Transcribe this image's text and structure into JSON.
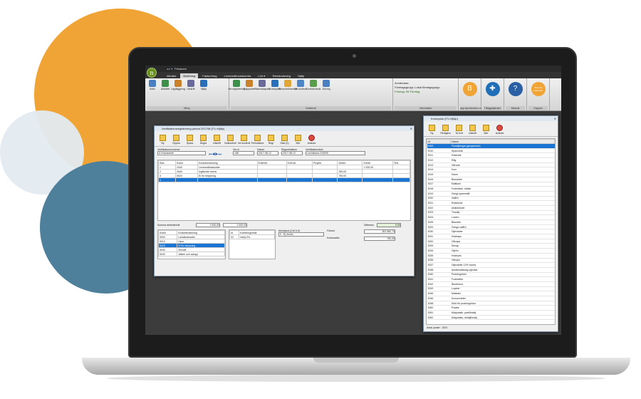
{
  "app": {
    "window_title": "Pekakam",
    "tabs": [
      "Allmänt",
      "Bokföring",
      "Fakturering",
      "Leverantörsreskontra",
      "Lön ▾",
      "Tidredovisning",
      "Hjälp"
    ],
    "active_tab": "Bokföring"
  },
  "ribbon": {
    "groups": [
      {
        "title": "Meny",
        "buttons": [
          "Arkiv",
          "Aktivitet",
          "Uppläggning",
          "Utskrift",
          "Hjälp"
        ]
      },
      {
        "title": "Snabbval",
        "buttons": [
          "Ver.registrering",
          "Rapporter",
          "Räkenskapsår",
          "Kontoplan",
          "Ekonomiöversikt",
          "Ver.kontroll",
          "Kontokontroll",
          "Anl.reg"
        ]
      },
      {
        "title": "Information",
        "lines": [
          "Användare:",
          "Företagsgrupp: Lokal företagsgrupp",
          "Företag: f9t Företag"
        ]
      }
    ],
    "links": [
      {
        "label": "app.bjornlunden.se",
        "text": "B",
        "color": "#f0a435"
      },
      {
        "label": "Tilläggstjänster",
        "text": "✚",
        "color": "#1e6fb8"
      },
      {
        "label": "Manual",
        "text": "?",
        "color": "#2a5fa3"
      },
      {
        "label": "Support",
        "text": "Skriv till supporten",
        "color": "#f0a435"
      }
    ]
  },
  "ver_window": {
    "title": "Verifikationsregistrering period 201708 (F1=Hjälp)",
    "toolbar": [
      "Ny",
      "Öppna",
      "Spara",
      "Ångra",
      "Utskrift",
      "Nolkontroll",
      "Ver.kontroll",
      "Periodisera",
      "Regr",
      "Disk (0)",
      "Mer",
      "Avsluta"
    ],
    "labels": {
      "verifikationsnummer": "Verifikationsnummer",
      "ver_nr": "Ver.nr",
      "datum": "Datum",
      "rapportdatum": "Rapportdatum",
      "verifikationstext": "Verifikationstext"
    },
    "fields": {
      "series": "A Huvudserie",
      "ver_nr": "158",
      "datum": "2017-08-12",
      "rapportdatum": "2017-08-12",
      "text": "Lev.faktura 215009"
    },
    "columns": [
      "Rad",
      "Konto",
      "Kontobenämning",
      "Kvitt/Ver",
      "Kr/Kvitt",
      "Projekt",
      "Debet",
      "Kredit",
      "Text"
    ],
    "rows": [
      {
        "rad": "1",
        "konto": "2440",
        "namn": "Leverantörsskulder",
        "debet": "",
        "kredit": "1 000,00"
      },
      {
        "rad": "2",
        "konto": "2640",
        "namn": "Ingående moms",
        "debet": "250,00",
        "kredit": ""
      },
      {
        "rad": "3",
        "konto": "5020",
        "namn": "El för belysning",
        "debet": "750,00",
        "kredit": ""
      },
      {
        "rad": "4",
        "konto": "",
        "namn": "",
        "debet": "",
        "kredit": ""
      }
    ],
    "summa_label": "Summa debet/kredit",
    "summa_debet": "1 000,00",
    "summa_kredit": "1 000,00",
    "differens_label": "Differens",
    "differens": "0,00",
    "kontolist_columns": [
      "Konto",
      "Kontobenämning"
    ],
    "kontolist": [
      {
        "konto": "5000",
        "namn": "Lokalkostnader"
      },
      {
        "konto": "5010",
        "namn": "Hyra"
      },
      {
        "konto": "5020",
        "namn": "El för belysning"
      },
      {
        "konto": "5030",
        "namn": "Ärende"
      },
      {
        "konto": "5040",
        "namn": "Vatten och avlopp"
      }
    ],
    "kontering_columns": [
      "Id",
      "Konteringsmall"
    ],
    "kontering": [
      {
        "id": "02",
        "namn": "inköp EU"
      }
    ],
    "momskod_label": "Momskod (Ctrl 0-9)",
    "momskod": "0 - Ej moms",
    "forlust_label": "Förlust",
    "forlust": "351 560,74",
    "kontosaldo_label": "Kontosaldo",
    "kontosaldo": "750,00"
  },
  "konto_window": {
    "title": "Kontoplan (F1=Hjälp)",
    "toolbar": [
      "Ny",
      "Redigera",
      "Ta bort",
      "Utskrift",
      "Mer",
      "Avsluta"
    ],
    "columns": [
      "Id",
      "Namn"
    ],
    "rows": [
      {
        "id": "3000",
        "namn": "Försäljningar (grupperare)"
      },
      {
        "id": "3010",
        "namn": "Spannmål"
      },
      {
        "id": "3011",
        "namn": "Höstvete"
      },
      {
        "id": "3012",
        "namn": "Råg"
      },
      {
        "id": "3013",
        "namn": "Vårvete"
      },
      {
        "id": "3014",
        "namn": "Korn"
      },
      {
        "id": "3015",
        "namn": "Havre"
      },
      {
        "id": "3016",
        "namn": "Blandsäd"
      },
      {
        "id": "3017",
        "namn": "Maltkorn"
      },
      {
        "id": "3018",
        "namn": "Foderärter, rikster"
      },
      {
        "id": "3019",
        "namn": "Övrigt spannmål"
      },
      {
        "id": "3020",
        "namn": "Vallfrö"
      },
      {
        "id": "3021",
        "namn": "Rödklöver"
      },
      {
        "id": "3022",
        "namn": "Alsikeklöver"
      },
      {
        "id": "3023",
        "namn": "Timotej"
      },
      {
        "id": "3024",
        "namn": "Lusern"
      },
      {
        "id": "3025",
        "namn": "Blandfrö"
      },
      {
        "id": "3029",
        "namn": "Övriga vallfrö"
      },
      {
        "id": "3030",
        "namn": "Oljeväxter"
      },
      {
        "id": "3031",
        "namn": "Höstraps"
      },
      {
        "id": "3032",
        "namn": "Vårraps"
      },
      {
        "id": "3033",
        "namn": "Senap"
      },
      {
        "id": "3034",
        "namn": "Oljelin"
      },
      {
        "id": "3035",
        "namn": "Höstrybs"
      },
      {
        "id": "3036",
        "namn": "Vårrybs"
      },
      {
        "id": "3037",
        "namn": "Oljeväxter 12% moms"
      },
      {
        "id": "3038",
        "namn": "Arealersättning oljeväxt"
      },
      {
        "id": "3040",
        "namn": "Proteingrödor"
      },
      {
        "id": "3041",
        "namn": "Foderärter"
      },
      {
        "id": "3042",
        "namn": "Åkerbönor"
      },
      {
        "id": "3043",
        "namn": "Lupiner"
      },
      {
        "id": "3045",
        "namn": "Matärter"
      },
      {
        "id": "3046",
        "namn": "Konservärter"
      },
      {
        "id": "3048",
        "namn": "Stöd för proteingrödor"
      },
      {
        "id": "3050",
        "namn": "Potatis"
      },
      {
        "id": "3051",
        "namn": "Matpotatis, partiförsälj"
      },
      {
        "id": "3052",
        "namn": "Matpotatis, detaljförsälj"
      }
    ],
    "selected_id": "3000",
    "footer": "Antal poster : 2001"
  }
}
